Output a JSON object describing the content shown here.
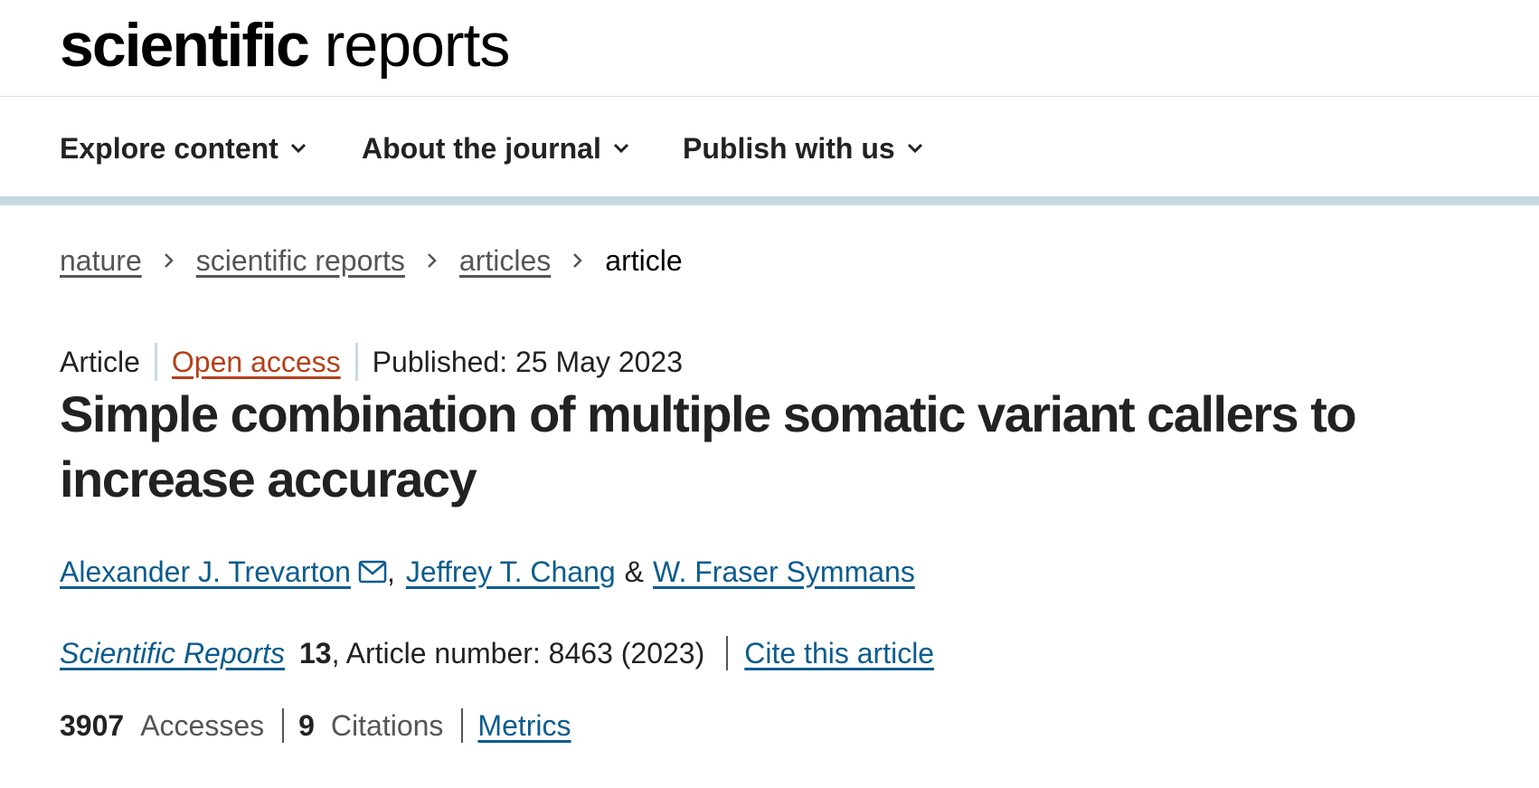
{
  "site": {
    "logo_bold": "scientific",
    "logo_light": "reports"
  },
  "nav": {
    "items": [
      {
        "label": "Explore content"
      },
      {
        "label": "About the journal"
      },
      {
        "label": "Publish with us"
      }
    ]
  },
  "breadcrumb": {
    "items": [
      "nature",
      "scientific reports",
      "articles"
    ],
    "current": "article"
  },
  "article": {
    "type": "Article",
    "access": "Open access",
    "published": "Published: 25 May 2023",
    "title": "Simple combination of multiple somatic variant callers to increase accuracy",
    "authors": [
      "Alexander J. Trevarton",
      "Jeffrey T. Chang",
      "W. Fraser Symmans"
    ],
    "author_sep_comma": ",",
    "author_sep_amp": "&",
    "journal": "Scientific Reports",
    "volume": "13",
    "article_number": ", Article number: 8463 (2023)",
    "cite_label": "Cite this article"
  },
  "metrics": {
    "accesses_value": "3907",
    "accesses_label": "Accesses",
    "citations_value": "9",
    "citations_label": "Citations",
    "metrics_link": "Metrics"
  },
  "colors": {
    "link_blue": "#0b5c8e",
    "open_access_orange": "#b5401a",
    "nav_rule": "#c6d9e2",
    "text": "#222222"
  },
  "icons": {
    "nav_dropdown": "chevron-down-icon",
    "breadcrumb_separator": "chevron-right-icon",
    "author_contact": "envelope-icon"
  }
}
